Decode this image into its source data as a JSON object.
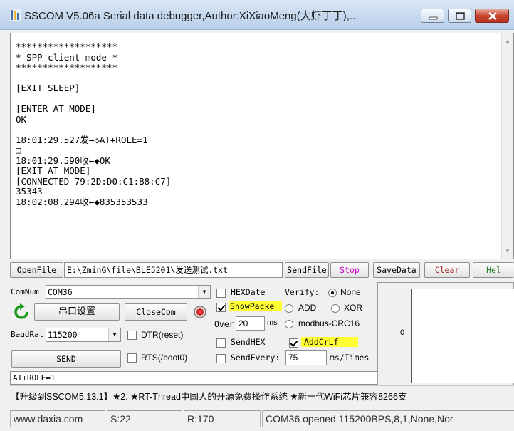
{
  "window": {
    "title": "SSCOM V5.06a Serial data debugger,Author:XiXiaoMeng(大虾丁丁),..."
  },
  "receive": {
    "lines": [
      "*******************",
      "* SPP client mode *",
      "*******************",
      "",
      "[EXIT SLEEP]",
      "",
      "[ENTER AT MODE]",
      "OK",
      "",
      "18:01:29.527发→◇AT+ROLE=1",
      "□",
      "18:01:29.590收←◆OK",
      "[EXIT AT MODE]",
      "[CONNECTED 79:2D:D0:C1:B8:C7]",
      "35343",
      "18:02:08.294收←◆835353533"
    ]
  },
  "file_row": {
    "open_file": "OpenFile",
    "file_path": "E:\\ZminG\\file\\BLE5201\\发送测试.txt",
    "send_file": "SendFile",
    "stop": "Stop",
    "save_data": "SaveData",
    "clear": "Clear",
    "help": "Hel"
  },
  "port": {
    "com_num_label": "ComNum",
    "com_num_value": "COM36",
    "serial_settings": "串口设置",
    "close_com": "CloseCom",
    "baud_label": "BaudRat",
    "baud_value": "115200",
    "dtr_label": "DTR(reset)",
    "rts_label": "RTS(/boot0)",
    "send_button": "SEND"
  },
  "options": {
    "hex_date": "HEXDate",
    "show_packet": "ShowPacke",
    "over_label": "Over",
    "over_value": "20",
    "ms_label": "ms",
    "send_hex": "SendHEX",
    "send_every": "SendEvery:",
    "send_every_value": "75",
    "ms_times": "ms/Times",
    "verify_label": "Verify:",
    "verify_none": "None",
    "verify_add": "ADD",
    "verify_xor": "XOR",
    "verify_modbus": "modbus-CRC16",
    "add_crlf": "AddCrLf"
  },
  "graph": {
    "zero_label": "0"
  },
  "send_input": {
    "value": "AT+ROLE=1"
  },
  "ad_text": "【升级到SSCOM5.13.1】★2. ★RT-Thread中国人的开源免费操作系统 ★新一代WiFi芯片兼容8266支",
  "status": {
    "website": "www.daxia.com",
    "sent": "S:22",
    "received": "R:170",
    "port_state": "COM36 opened  115200BPS,8,1,None,Nor"
  },
  "colors": {
    "highlight": "#ffff33",
    "stop_text": "#cc00cc",
    "clear_text": "#aa2222",
    "help_text": "#2a7a2a"
  }
}
